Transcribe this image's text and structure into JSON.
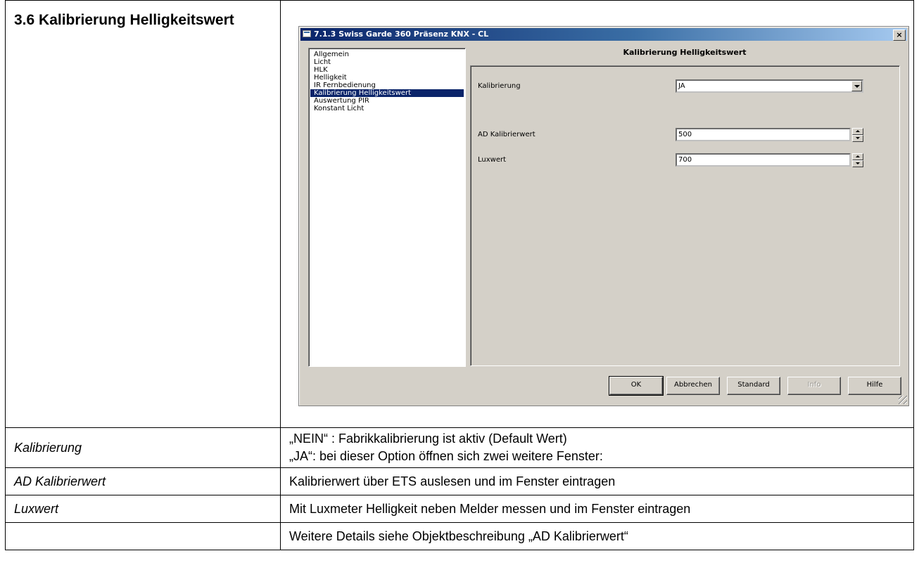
{
  "section": {
    "title": "3.6  Kalibrierung Helligkeitswert"
  },
  "dialog": {
    "title": "7.1.3 Swiss Garde 360 Präsenz KNX - CL",
    "close_label": "×",
    "tree_items": [
      "Allgemein",
      "Licht",
      "HLK",
      "Helligkeit",
      "IR Fernbedienung",
      "Kalibrierung Helligkeitswert",
      "Auswertung PIR",
      "Konstant Licht"
    ],
    "selected_item": "Kalibrierung Helligkeitswert",
    "panel_title": "Kalibrierung Helligkeitswert",
    "kalibrierung": {
      "label": "Kalibrierung",
      "value": "JA"
    },
    "ad": {
      "label": "AD Kalibrierwert",
      "value": "500"
    },
    "lux": {
      "label": "Luxwert",
      "value": "700"
    },
    "buttons": {
      "ok": "OK",
      "cancel": "Abbrechen",
      "standard": "Standard",
      "info": "Info",
      "help": "Hilfe"
    }
  },
  "rows": [
    {
      "term": "Kalibrierung",
      "lines": [
        "„NEIN“ : Fabrikkalibrierung ist aktiv (Default Wert)",
        "„JA“: bei dieser Option öffnen sich zwei weitere Fenster:"
      ]
    },
    {
      "term": "AD Kalibrierwert",
      "lines": [
        "Kalibrierwert über ETS auslesen und im Fenster eintragen"
      ]
    },
    {
      "term": "Luxwert",
      "lines": [
        "Mit Luxmeter Helligkeit neben Melder messen und im Fenster eintragen"
      ]
    },
    {
      "term": "",
      "lines": [
        "Weitere Details siehe Objektbeschreibung „AD Kalibrierwert“"
      ]
    }
  ]
}
